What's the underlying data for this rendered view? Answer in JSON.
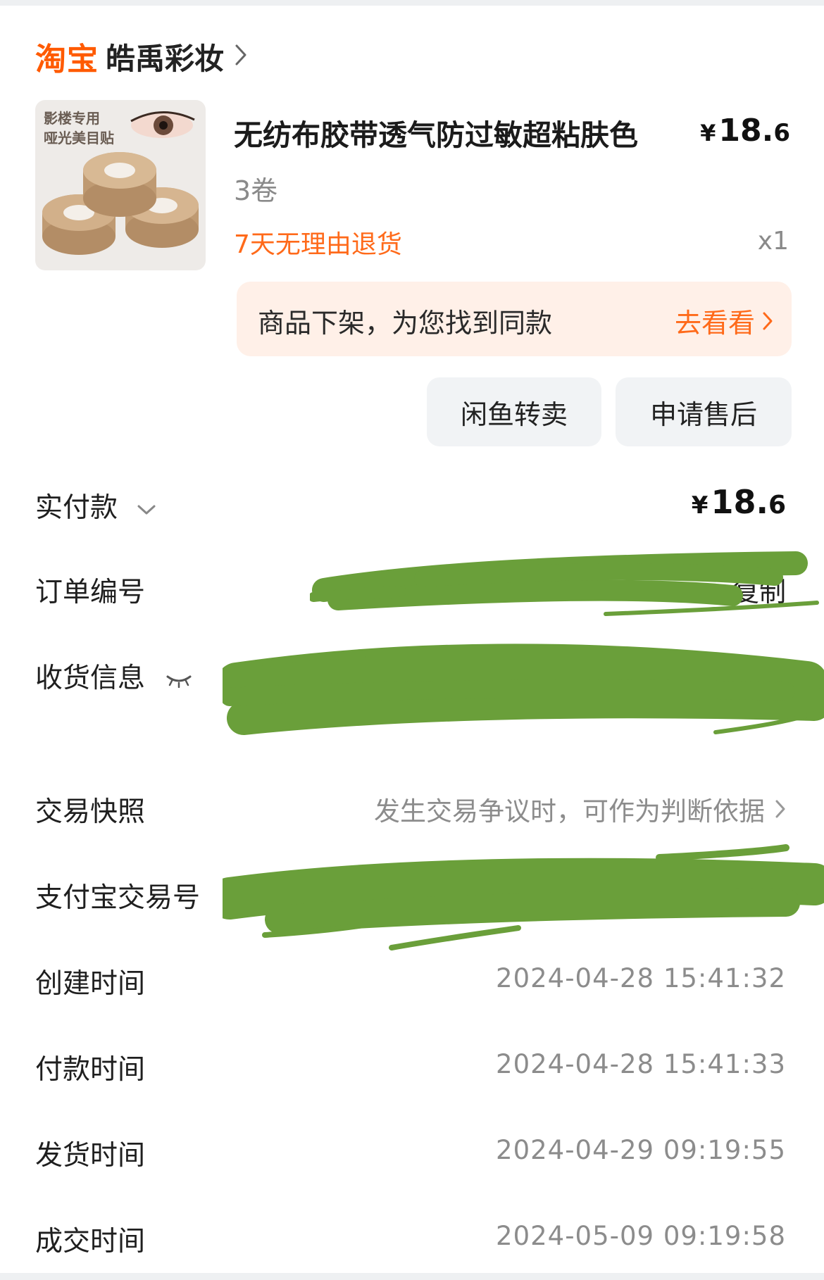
{
  "shop": {
    "platform": "淘宝",
    "name": "皓禹彩妆"
  },
  "product": {
    "thumb_text_1": "影楼专用",
    "thumb_text_2": "哑光美目贴",
    "title": "无纺布胶带透气防过敏超粘肤色",
    "price_symbol": "¥",
    "price_int": "18.",
    "price_dec": "6",
    "spec": "3卷",
    "return_policy": "7天无理由退货",
    "quantity": "x1"
  },
  "banner": {
    "text": "商品下架，为您找到同款",
    "cta": "去看看"
  },
  "actions": {
    "resell_label": "闲鱼转卖",
    "aftersale_label": "申请售后"
  },
  "order_info": {
    "paid_label": "实付款",
    "paid_symbol": "¥",
    "paid_int": "18.",
    "paid_dec": "6",
    "order_no_label": "订单编号",
    "copy_label": "复制",
    "shipping_label": "收货信息",
    "snapshot_label": "交易快照",
    "snapshot_value": "发生交易争议时，可作为判断依据",
    "alipay_label": "支付宝交易号",
    "created_label": "创建时间",
    "created_value": "2024-04-28 15:41:32",
    "paytime_label": "付款时间",
    "paytime_value": "2024-04-28 15:41:33",
    "shiptime_label": "发货时间",
    "shiptime_value": "2024-04-29 09:19:55",
    "donetime_label": "成交时间",
    "donetime_value": "2024-05-09 09:19:58"
  },
  "colors": {
    "accent": "#ff6a1a",
    "brand": "#ff5a00",
    "redaction": "#6a9f3a",
    "banner_bg": "#fff0e8"
  }
}
